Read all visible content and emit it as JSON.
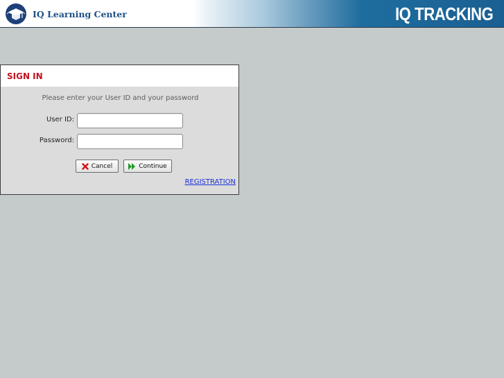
{
  "header": {
    "org_name": "IQ Learning Center",
    "brand": "IQ TRACKING"
  },
  "signin": {
    "title": "SIGN IN",
    "instructions": "Please enter your User ID and your password",
    "user_id_label": "User ID:",
    "user_id_value": "",
    "password_label": "Password:",
    "password_value": "",
    "cancel_label": "Cancel",
    "continue_label": "Continue",
    "registration_label": "REGISTRATION"
  },
  "colors": {
    "background": "#c5cacb",
    "title_red": "#c0121f",
    "link_blue": "#1a2fd6",
    "logo_blue": "#1d4f86",
    "header_blue": "#1a5f92"
  },
  "icons": {
    "logo": "graduation-cap-globe-icon",
    "cancel": "red-x-icon",
    "continue": "green-double-arrow-icon"
  }
}
